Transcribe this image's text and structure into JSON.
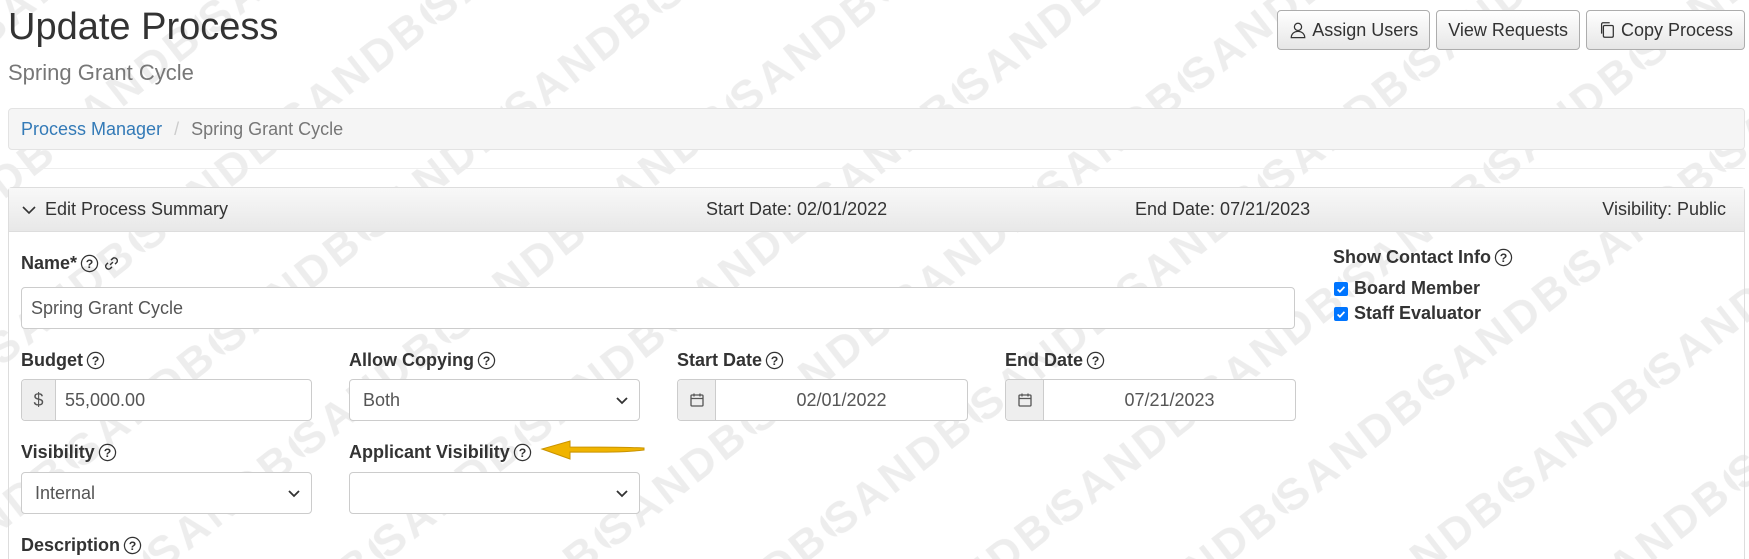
{
  "header": {
    "title": "Update Process",
    "subtitle": "Spring Grant Cycle",
    "buttons": {
      "assign_users": "Assign Users",
      "view_requests": "View Requests",
      "copy_process": "Copy Process"
    }
  },
  "breadcrumb": {
    "root": "Process Manager",
    "separator": "/",
    "current": "Spring Grant Cycle"
  },
  "panel": {
    "title": "Edit Process Summary",
    "start_date": "Start Date: 02/01/2022",
    "end_date": "End Date: 07/21/2023",
    "visibility": "Visibility: Public"
  },
  "form": {
    "name": {
      "label": "Name*",
      "value": "Spring Grant Cycle"
    },
    "budget": {
      "label": "Budget",
      "prefix": "$",
      "value": "55,000.00"
    },
    "allow_copying": {
      "label": "Allow Copying",
      "value": "Both"
    },
    "start_date": {
      "label": "Start Date",
      "value": "02/01/2022"
    },
    "end_date": {
      "label": "End Date",
      "value": "07/21/2023"
    },
    "visibility": {
      "label": "Visibility",
      "value": "Internal"
    },
    "applicant_visibility": {
      "label": "Applicant Visibility",
      "value": ""
    },
    "description": {
      "label": "Description"
    }
  },
  "contact_info": {
    "label": "Show Contact Info",
    "options": [
      {
        "label": "Board Member",
        "checked": true
      },
      {
        "label": "Staff Evaluator",
        "checked": true
      }
    ]
  },
  "watermark": {
    "text": "SANDBOX"
  },
  "colors": {
    "link": "#337ab7",
    "checkbox": "#0075ff",
    "arrow": "#f0b400"
  }
}
